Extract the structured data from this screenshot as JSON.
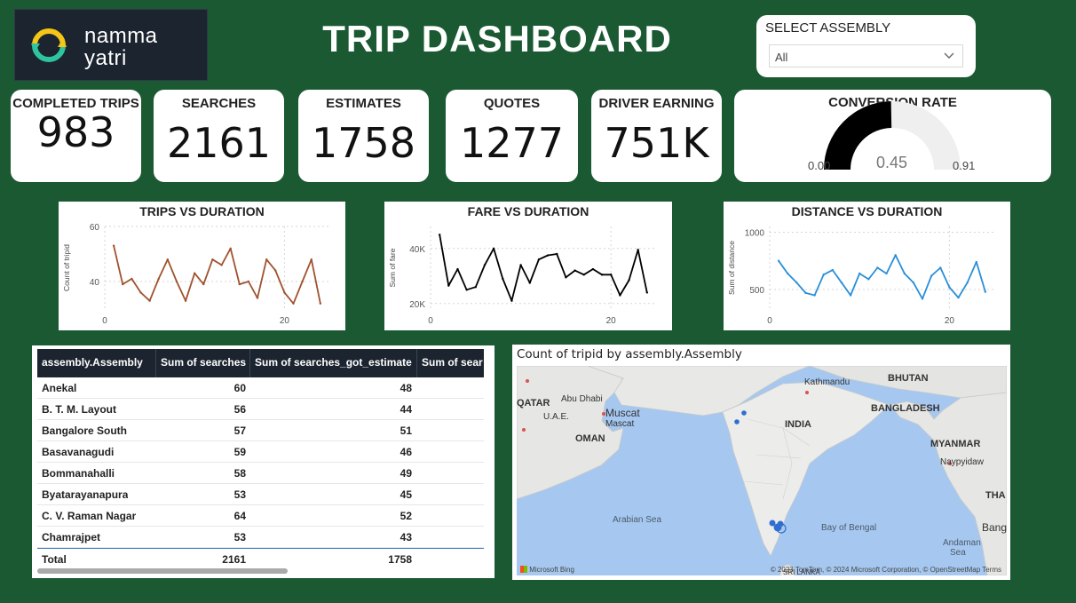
{
  "header": {
    "logo_line1": "namma",
    "logo_line2": "yatri",
    "title": "TRIP DASHBOARD"
  },
  "slicer": {
    "label": "SELECT ASSEMBLY",
    "value": "All"
  },
  "kpis": [
    {
      "label": "COMPLETED TRIPS",
      "value": "983"
    },
    {
      "label": "SEARCHES",
      "value": "2161"
    },
    {
      "label": "ESTIMATES",
      "value": "1758"
    },
    {
      "label": "QUOTES",
      "value": "1277"
    },
    {
      "label": "DRIVER EARNING",
      "value": "751K"
    }
  ],
  "gauge": {
    "label": "CONVERSION RATE",
    "min": "0.00",
    "max": "0.91",
    "value": "0.45",
    "value_num": 0.45,
    "max_num": 0.91,
    "fill_color": "#000000",
    "track_color": "#efefef"
  },
  "chart_data": [
    {
      "type": "line",
      "title": "TRIPS VS DURATION",
      "xlabel": "",
      "ylabel": "Count of tripid",
      "color": "#a0522d",
      "xlim": [
        0,
        25
      ],
      "ylim": [
        30,
        60
      ],
      "xticks": [
        0,
        20
      ],
      "yticks": [
        40,
        60
      ],
      "ytick_labels": [
        "40",
        "60"
      ],
      "x": [
        1,
        2,
        3,
        4,
        5,
        6,
        7,
        8,
        9,
        10,
        11,
        12,
        13,
        14,
        15,
        16,
        17,
        18,
        19,
        20,
        21,
        22,
        23,
        24
      ],
      "values": [
        53,
        39,
        41,
        36,
        33,
        41,
        48,
        40,
        33,
        43,
        39,
        48,
        46,
        52,
        39,
        40,
        34,
        48,
        44,
        36,
        32,
        40,
        48,
        32
      ]
    },
    {
      "type": "line",
      "title": "FARE VS DURATION",
      "xlabel": "",
      "ylabel": "Sum of fare",
      "color": "#000000",
      "xlim": [
        0,
        25
      ],
      "ylim": [
        18000,
        48000
      ],
      "xticks": [
        0,
        20
      ],
      "yticks": [
        20000,
        40000
      ],
      "ytick_labels": [
        "20K",
        "40K"
      ],
      "x": [
        1,
        2,
        3,
        4,
        5,
        6,
        7,
        8,
        9,
        10,
        11,
        12,
        13,
        14,
        15,
        16,
        17,
        18,
        19,
        20,
        21,
        22,
        23,
        24
      ],
      "values": [
        45000,
        26500,
        32500,
        25000,
        26000,
        34000,
        40000,
        29000,
        21000,
        34000,
        27500,
        36000,
        37500,
        38000,
        29500,
        32000,
        30500,
        32500,
        30500,
        30500,
        23000,
        28500,
        39500,
        24000
      ]
    },
    {
      "type": "line",
      "title": "DISTANCE VS DURATION",
      "xlabel": "",
      "ylabel": "Sum of distance",
      "color": "#2a8fd8",
      "xlim": [
        0,
        25
      ],
      "ylim": [
        330,
        1050
      ],
      "xticks": [
        0,
        20
      ],
      "yticks": [
        500,
        1000
      ],
      "ytick_labels": [
        "500",
        "1000"
      ],
      "x": [
        1,
        2,
        3,
        4,
        5,
        6,
        7,
        8,
        9,
        10,
        11,
        12,
        13,
        14,
        15,
        16,
        17,
        18,
        19,
        20,
        21,
        22,
        23,
        24
      ],
      "values": [
        750,
        640,
        560,
        470,
        450,
        630,
        670,
        560,
        450,
        640,
        590,
        690,
        640,
        800,
        640,
        560,
        420,
        620,
        690,
        520,
        430,
        560,
        740,
        480
      ]
    }
  ],
  "table": {
    "columns": [
      "assembly.Assembly",
      "Sum of searches",
      "Sum of searches_got_estimate",
      "Sum of sear"
    ],
    "rows": [
      {
        "name": "Anekal",
        "searches": "60",
        "estimate": "48"
      },
      {
        "name": "B. T. M. Layout",
        "searches": "56",
        "estimate": "44"
      },
      {
        "name": "Bangalore South",
        "searches": "57",
        "estimate": "51"
      },
      {
        "name": "Basavanagudi",
        "searches": "59",
        "estimate": "46"
      },
      {
        "name": "Bommanahalli",
        "searches": "58",
        "estimate": "49"
      },
      {
        "name": "Byatarayanapura",
        "searches": "53",
        "estimate": "45"
      },
      {
        "name": "C. V. Raman Nagar",
        "searches": "64",
        "estimate": "52"
      },
      {
        "name": "Chamrajpet",
        "searches": "53",
        "estimate": "43"
      }
    ],
    "total": {
      "name": "Total",
      "searches": "2161",
      "estimate": "1758"
    }
  },
  "map": {
    "title": "Count of tripid by assembly.Assembly",
    "labels": {
      "kathmandu": "Kathmandu",
      "bhutan": "BHUTAN",
      "qatar": "QATAR",
      "abu_dhabi": "Abu Dhabi",
      "uae": "U.A.E.",
      "muscat_1": "Muscat",
      "muscat_2": "Mascat",
      "oman": "OMAN",
      "india": "INDIA",
      "bangladesh": "BANGLADESH",
      "myanmar": "MYANMAR",
      "naypyidaw": "Naypyidaw",
      "tha": "THA",
      "bang": "Bang",
      "arabian_sea": "Arabian Sea",
      "bay_of_bengal": "Bay of Bengal",
      "andaman_sea_1": "Andaman",
      "andaman_sea_2": "Sea",
      "sri_lanka": "SRI LANKA"
    },
    "bing": "Microsoft Bing",
    "attribution": "© 2023 TomTom, © 2024 Microsoft Corporation, © OpenStreetMap  Terms",
    "land_color": "#e8e8e6",
    "water_color": "#a6c8f0",
    "point_color": "#2f6fd1"
  }
}
